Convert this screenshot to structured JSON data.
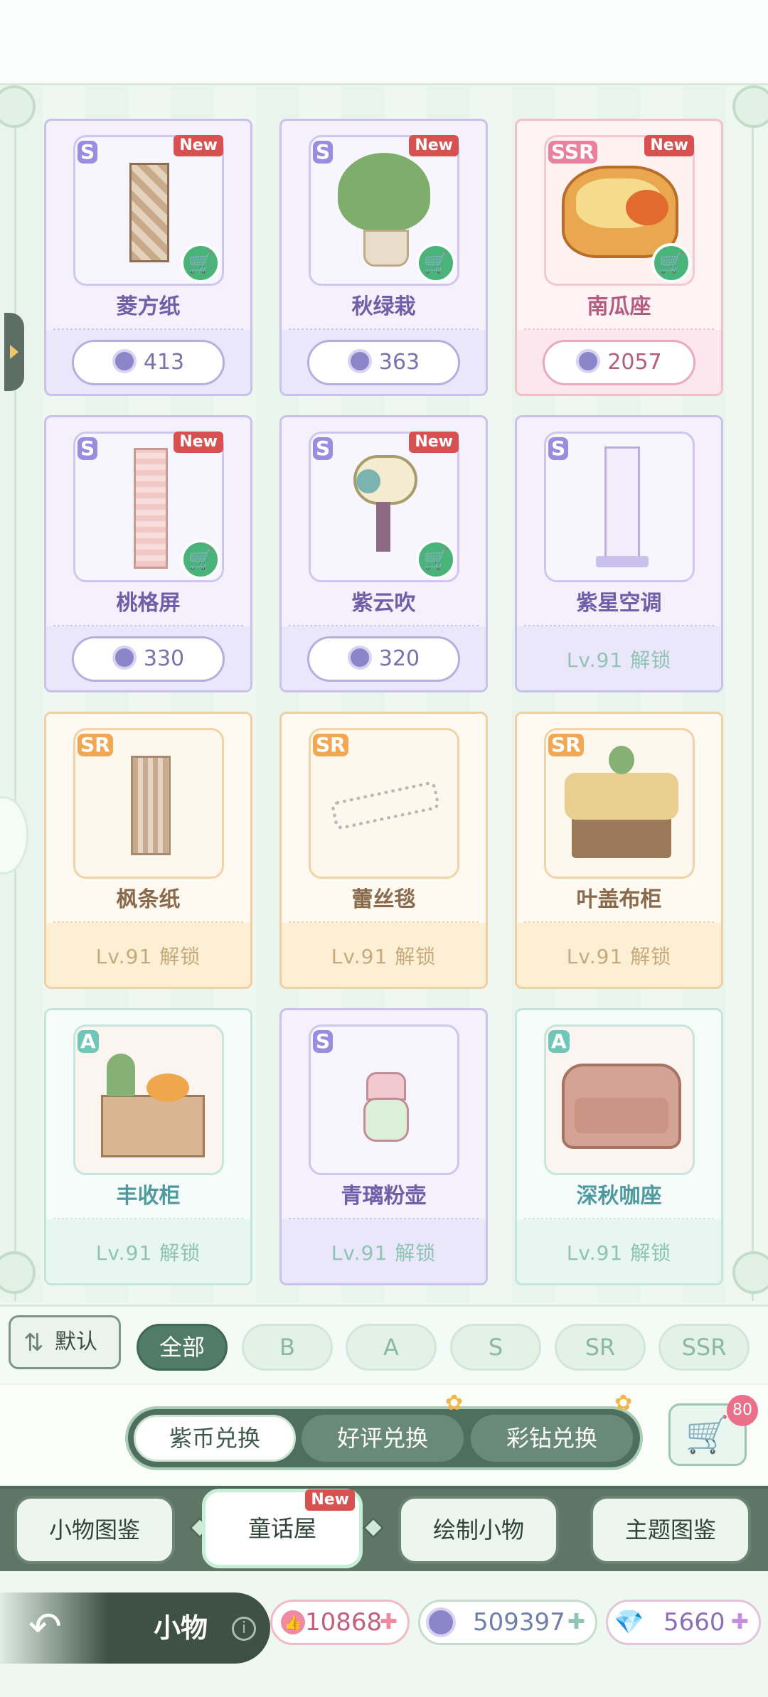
{
  "items": [
    {
      "name": "菱方纸",
      "rank": "S",
      "new": "New",
      "price": "413",
      "lock": ""
    },
    {
      "name": "秋绿栽",
      "rank": "S",
      "new": "New",
      "price": "363",
      "lock": ""
    },
    {
      "name": "南瓜座",
      "rank": "SSR",
      "new": "New",
      "price": "2057",
      "lock": ""
    },
    {
      "name": "桃格屏",
      "rank": "S",
      "new": "New",
      "price": "330",
      "lock": ""
    },
    {
      "name": "紫云吹",
      "rank": "S",
      "new": "New",
      "price": "320",
      "lock": ""
    },
    {
      "name": "紫星空调",
      "rank": "S",
      "new": "",
      "price": "",
      "lock": "Lv.91 解锁"
    },
    {
      "name": "枫条纸",
      "rank": "SR",
      "new": "",
      "price": "",
      "lock": "Lv.91 解锁"
    },
    {
      "name": "蕾丝毯",
      "rank": "SR",
      "new": "",
      "price": "",
      "lock": "Lv.91 解锁"
    },
    {
      "name": "叶盖布柜",
      "rank": "SR",
      "new": "",
      "price": "",
      "lock": "Lv.91 解锁"
    },
    {
      "name": "丰收柜",
      "rank": "A",
      "new": "",
      "price": "",
      "lock": "Lv.91 解锁"
    },
    {
      "name": "青璃粉壶",
      "rank": "S",
      "new": "",
      "price": "",
      "lock": "Lv.91 解锁"
    },
    {
      "name": "深秋咖座",
      "rank": "A",
      "new": "",
      "price": "",
      "lock": "Lv.91 解锁"
    }
  ],
  "filter": {
    "sort_label": "默认",
    "chips": [
      "全部",
      "B",
      "A",
      "S",
      "SR",
      "SSR"
    ]
  },
  "exchange": {
    "tabs": [
      "紫币兑换",
      "好评兑换",
      "彩钻兑换"
    ],
    "cart_badge": "80"
  },
  "nav_tabs": [
    {
      "label": "小物图鉴",
      "new": ""
    },
    {
      "label": "童话屋",
      "new": "New"
    },
    {
      "label": "绘制小物",
      "new": ""
    },
    {
      "label": "主题图鉴",
      "new": ""
    }
  ],
  "bottom": {
    "title": "小物",
    "info": "i",
    "currency_likes": "10868",
    "currency_coins": "509397",
    "currency_gems": "5660"
  },
  "colors": {
    "accent": "#4f7b67",
    "new_badge": "#d8504f"
  }
}
